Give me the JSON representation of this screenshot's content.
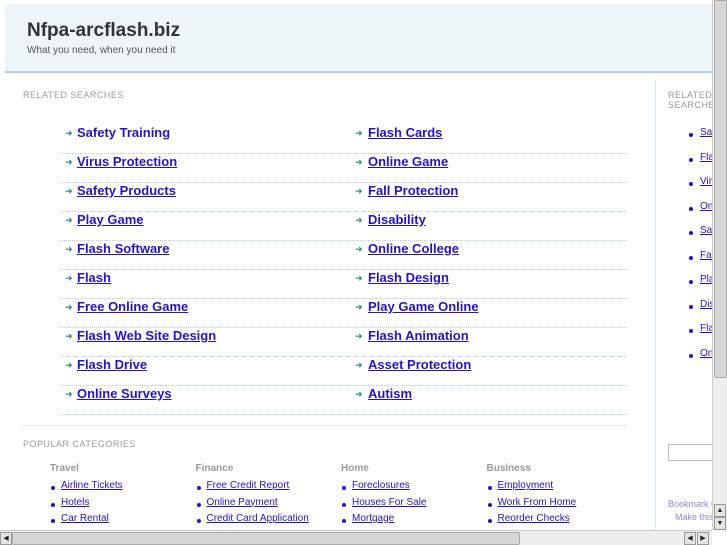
{
  "header": {
    "title": "Nfpa-arcflash.biz",
    "tagline": "What you need, when you need it"
  },
  "related": {
    "heading": "RELATED SEARCHES",
    "left": [
      "Safety Training",
      "Virus Protection",
      "Safety Products",
      "Play Game",
      "Flash Software",
      "Flash",
      "Free Online Game",
      "Flash Web Site Design",
      "Flash Drive",
      "Online Surveys"
    ],
    "right": [
      "Flash Cards",
      "Online Game",
      "Fall Protection",
      "Disability",
      "Online College",
      "Flash Design",
      "Play Game Online",
      "Flash Animation",
      "Asset Protection",
      "Autism"
    ]
  },
  "popular": {
    "heading": "POPULAR CATEGORIES",
    "columns": [
      {
        "title": "Travel",
        "items": [
          "Airline Tickets",
          "Hotels",
          "Car Rental"
        ]
      },
      {
        "title": "Finance",
        "items": [
          "Free Credit Report",
          "Online Payment",
          "Credit Card Application"
        ]
      },
      {
        "title": "Home",
        "items": [
          "Foreclosures",
          "Houses For Sale",
          "Mortgage"
        ]
      },
      {
        "title": "Business",
        "items": [
          "Employment",
          "Work From Home",
          "Reorder Checks"
        ]
      }
    ]
  },
  "sidebar": {
    "heading": "RELATED SEARCHES",
    "items": [
      "Safety Training",
      "Flash Cards",
      "Virus Protection",
      "Online Game",
      "Safety Products",
      "Fall Protection",
      "Play Game",
      "Disability",
      "Flash Software",
      "Online College"
    ],
    "bookmark": "Bookmark this page",
    "homepage": "Make this your homepage"
  },
  "colors": {
    "link": "#2414c8",
    "header_bg": "#eef5f8",
    "arrow": "#2a8a7a"
  }
}
